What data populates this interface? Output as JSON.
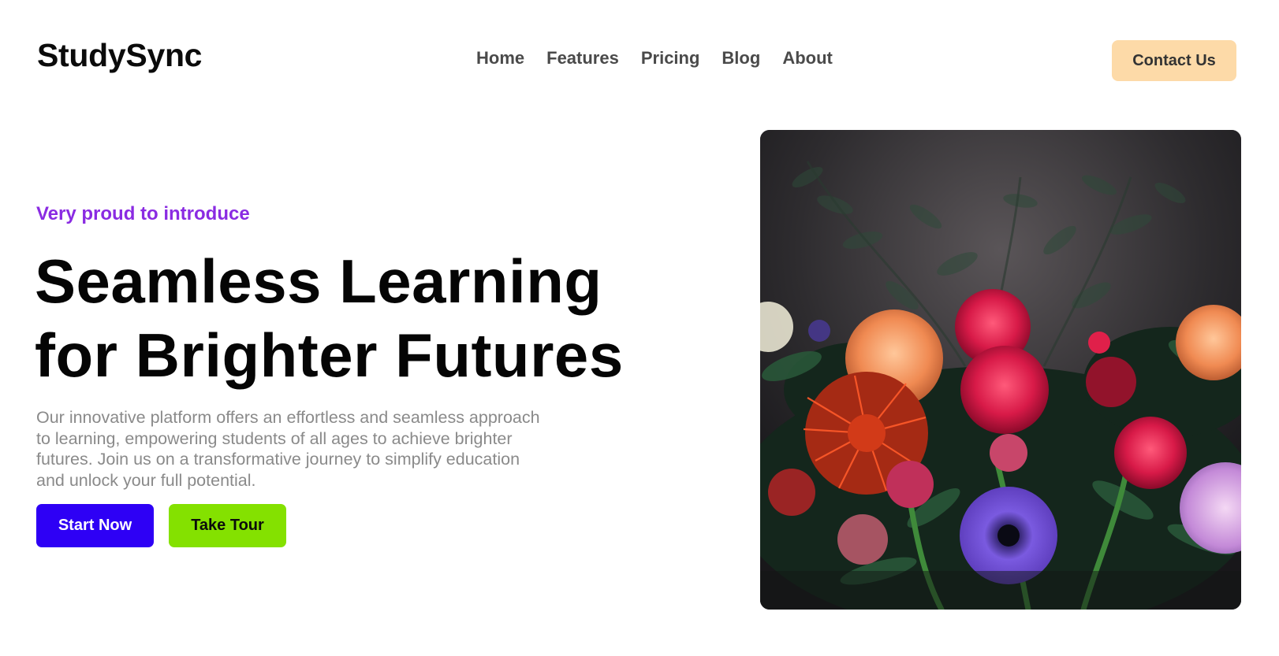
{
  "header": {
    "logo": "StudySync",
    "nav": [
      "Home",
      "Features",
      "Pricing",
      "Blog",
      "About"
    ],
    "contact_label": "Contact Us"
  },
  "hero": {
    "eyebrow": "Very proud to introduce",
    "headline_line1": "Seamless Learning",
    "headline_line2": "for Brighter Futures",
    "description": "Our innovative platform offers an effortless and seamless approach to learning, empowering students of all ages to achieve brighter futures. Join us on a transformative journey to simplify education and unlock your full potential.",
    "start_label": "Start Now",
    "tour_label": "Take Tour",
    "image_subject": "flower-bouquet-photo"
  },
  "colors": {
    "eyebrow": "#8a2be2",
    "start_button": "#2e00f5",
    "tour_button": "#84e100",
    "contact_button": "#fddaa8"
  }
}
